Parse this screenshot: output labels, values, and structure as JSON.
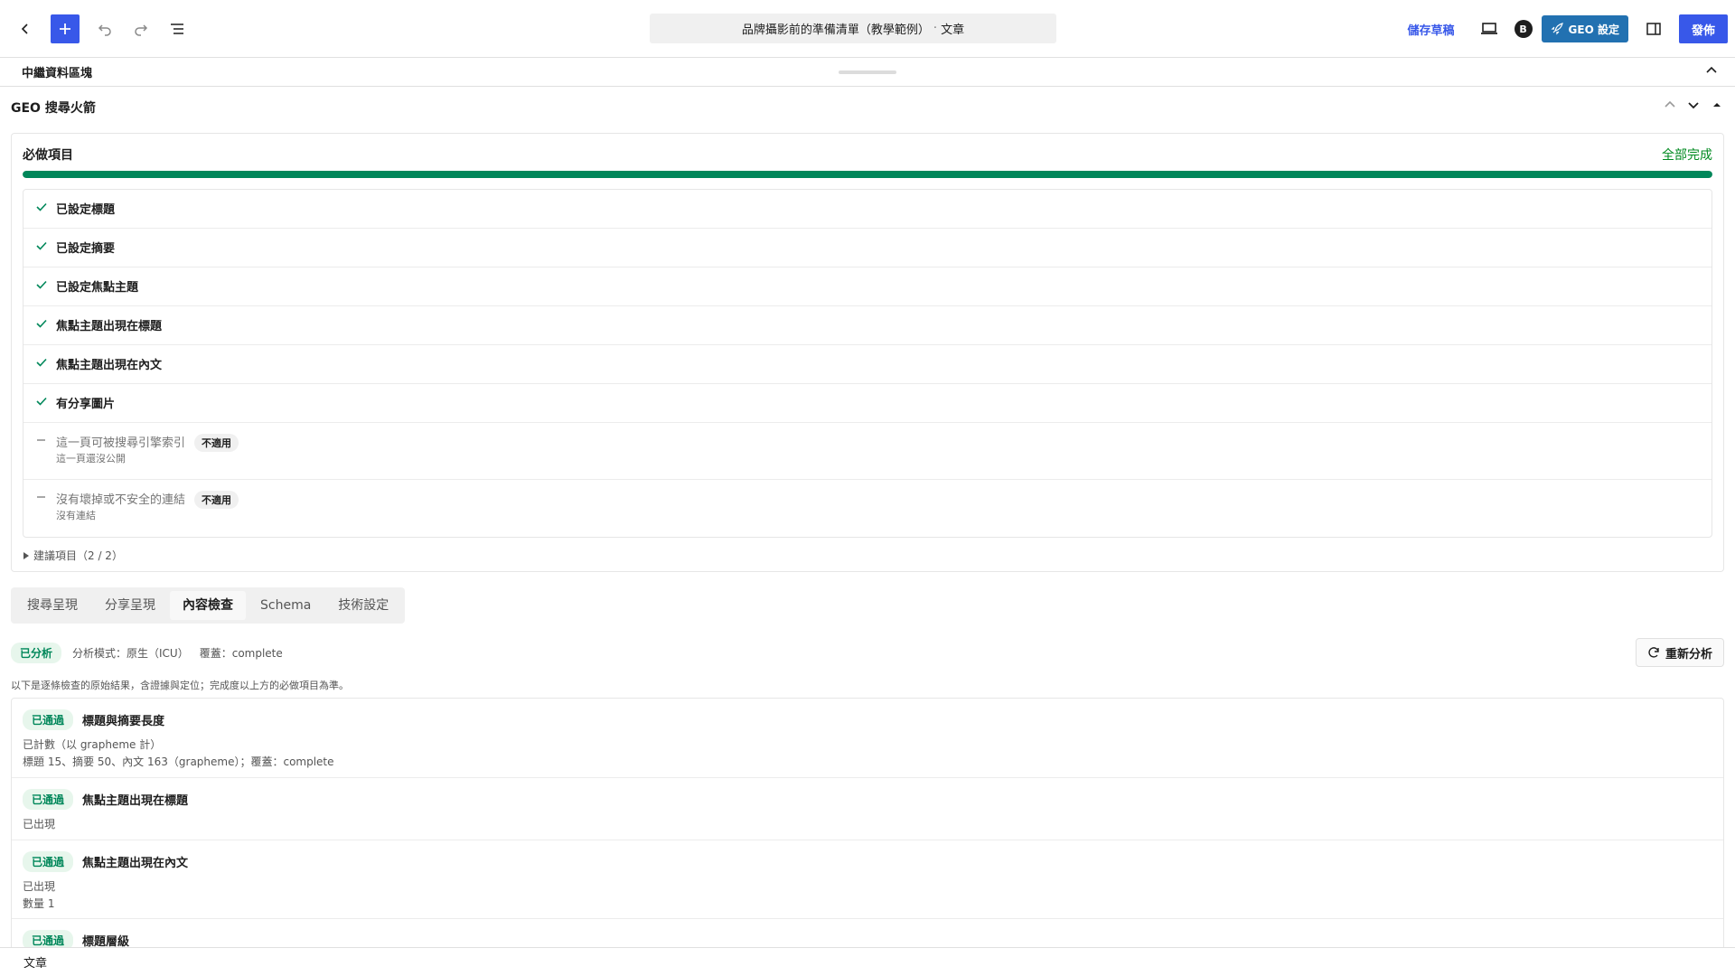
{
  "toolbar": {
    "doc_title": "品牌攝影前的準備清單（教學範例）",
    "doc_sep": "·",
    "doc_type": "文章",
    "save_draft": "儲存草稿",
    "avatar_letter": "B",
    "geo_button": "GEO 設定",
    "publish": "發佈"
  },
  "metabox": {
    "title": "中繼資料區塊"
  },
  "panel": {
    "title": "GEO 搜尋火箭"
  },
  "required": {
    "title": "必做項目",
    "status": "全部完成",
    "progress_percent": 100,
    "items": [
      {
        "label": "已設定標題"
      },
      {
        "label": "已設定摘要"
      },
      {
        "label": "已設定焦點主題"
      },
      {
        "label": "焦點主題出現在標題"
      },
      {
        "label": "焦點主題出現在內文"
      },
      {
        "label": "有分享圖片"
      },
      {
        "label": "這一頁可被搜尋引擎索引",
        "badge": "不適用",
        "sub": "這一頁還沒公開"
      },
      {
        "label": "沒有壞掉或不安全的連結",
        "badge": "不適用",
        "sub": "沒有連結"
      }
    ],
    "suggest_toggle": "建議項目（2 / 2）"
  },
  "tabs": [
    {
      "label": "搜尋呈現"
    },
    {
      "label": "分享呈現"
    },
    {
      "label": "內容檢查"
    },
    {
      "label": "Schema"
    },
    {
      "label": "技術設定"
    }
  ],
  "analysis": {
    "status_badge": "已分析",
    "mode": "分析模式：原生（ICU）",
    "coverage": "覆蓋：complete",
    "reanalyze": "重新分析",
    "note": "以下是逐條檢查的原始結果，含證據與定位；完成度以上方的必做項目為準。"
  },
  "results": [
    {
      "badge": "已通過",
      "title": "標題與摘要長度",
      "lines": [
        "已計數（以 grapheme 計）",
        "標題 15、摘要 50、內文 163（grapheme）；覆蓋：complete"
      ]
    },
    {
      "badge": "已通過",
      "title": "焦點主題出現在標題",
      "lines": [
        "已出現"
      ]
    },
    {
      "badge": "已通過",
      "title": "焦點主題出現在內文",
      "lines": [
        "已出現",
        "數量 1"
      ]
    },
    {
      "badge": "已通過",
      "title": "標題層級",
      "lines": []
    }
  ],
  "footer": {
    "label": "文章"
  },
  "colors": {
    "accent": "#3858e9",
    "geo_button": "#2271b1",
    "success": "#00875a"
  }
}
